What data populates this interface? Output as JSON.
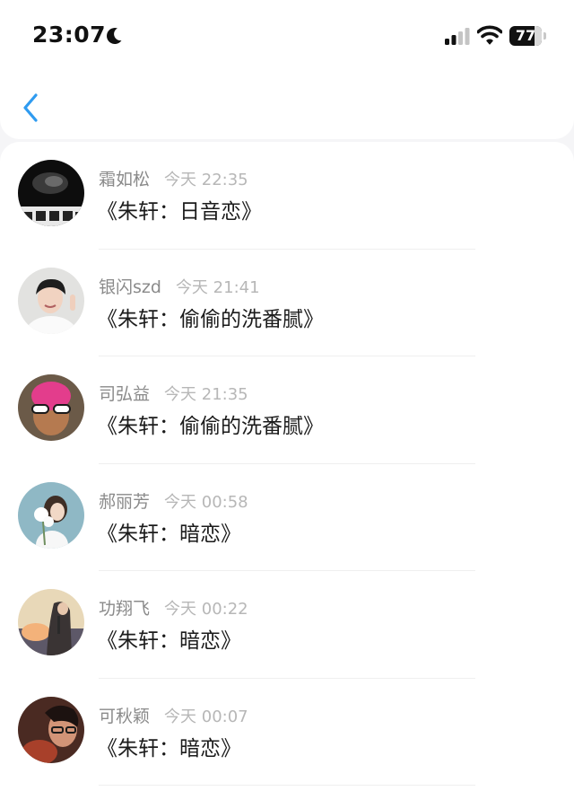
{
  "status_bar": {
    "time": "23:07",
    "battery": "77",
    "battery_level_percent": 77
  },
  "nav": {
    "back_icon": "chevron-left-icon",
    "accent_color": "#2f9bf0"
  },
  "messages": [
    {
      "name": "霜如松",
      "time": "今天 22:35",
      "song": "《朱轩：日音恋》"
    },
    {
      "name": "银闪szd",
      "time": "今天 21:41",
      "song": "《朱轩：偷偷的洗番腻》"
    },
    {
      "name": "司弘益",
      "time": "今天 21:35",
      "song": "《朱轩：偷偷的洗番腻》"
    },
    {
      "name": "郝丽芳",
      "time": "今天 00:58",
      "song": "《朱轩：暗恋》"
    },
    {
      "name": "功翔飞",
      "time": "今天 00:22",
      "song": "《朱轩：暗恋》"
    },
    {
      "name": "可秋颖",
      "time": "今天 00:07",
      "song": "《朱轩：暗恋》"
    }
  ]
}
